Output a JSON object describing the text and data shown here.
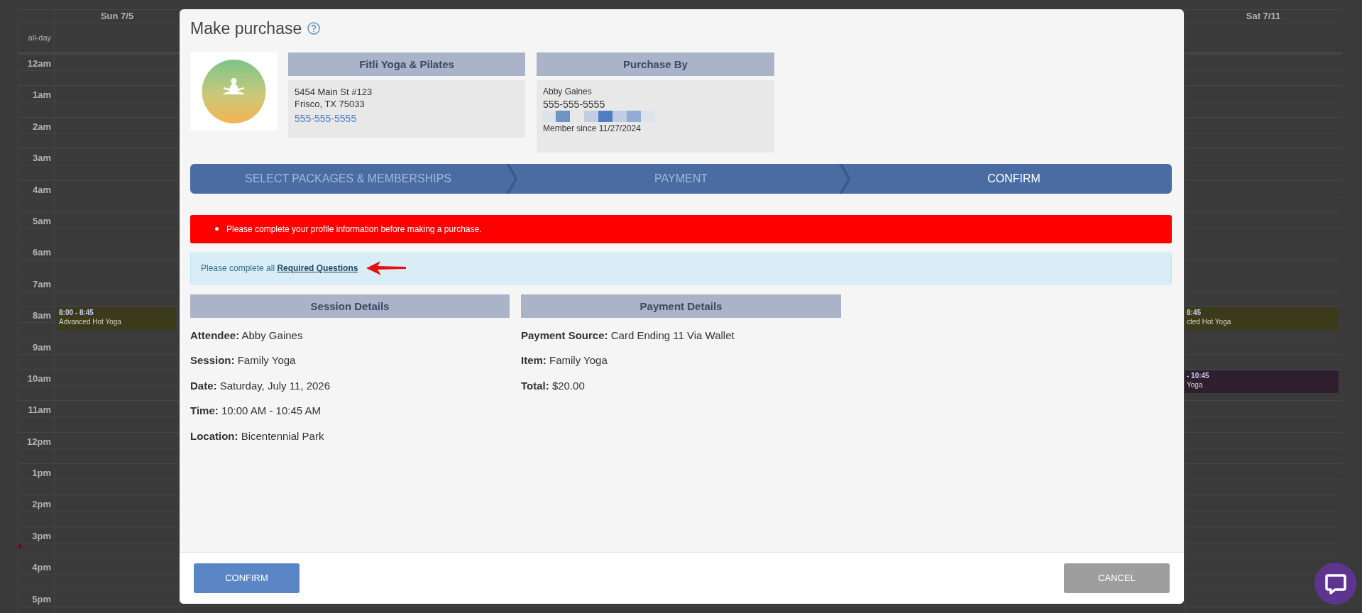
{
  "calendar": {
    "days": [
      {
        "label": "Sun 7/5"
      },
      {
        "label": "Sat 7/11"
      }
    ],
    "all_day_label": "all-day",
    "hours": [
      {
        "label": "12am",
        "now": false
      },
      {
        "label": "1am",
        "now": false
      },
      {
        "label": "2am",
        "now": false
      },
      {
        "label": "3am",
        "now": false
      },
      {
        "label": "4am",
        "now": false
      },
      {
        "label": "5am",
        "now": false
      },
      {
        "label": "6am",
        "now": false
      },
      {
        "label": "7am",
        "now": false
      },
      {
        "label": "8am",
        "now": false,
        "sun_event": {
          "time": "8:00 - 8:45",
          "title": "Advanced Hot Yoga",
          "color": "#3b3a1b"
        },
        "sat_event": {
          "time": "8:45",
          "title": "cted Hot Yoga",
          "color": "#3b3a1b"
        }
      },
      {
        "label": "9am",
        "now": false
      },
      {
        "label": "10am",
        "now": false,
        "sat_event": {
          "time": "- 10:45",
          "title": "Yoga",
          "color": "#2f1f2e"
        }
      },
      {
        "label": "11am",
        "now": false
      },
      {
        "label": "12pm",
        "now": false
      },
      {
        "label": "1pm",
        "now": false
      },
      {
        "label": "2pm",
        "now": false
      },
      {
        "label": "3pm",
        "now": true
      },
      {
        "label": "4pm",
        "now": false
      },
      {
        "label": "5pm",
        "now": false
      }
    ]
  },
  "modal": {
    "title": "Make purchase",
    "studio": {
      "heading": "Fitli Yoga & Pilates",
      "address_lines": [
        "5454 Main St #123",
        "Frisco, TX 75033"
      ],
      "phone": "555-555-5555"
    },
    "purchaser": {
      "heading": "Purchase By",
      "name": "Abby Gaines",
      "phone": "555-555-5555",
      "member_since": "Member since 11/27/2024"
    },
    "steps": [
      {
        "label": "SELECT PACKAGES & MEMBERSHIPS",
        "selected": false
      },
      {
        "label": "PAYMENT",
        "selected": false
      },
      {
        "label": "CONFIRM",
        "selected": true
      }
    ],
    "errors": [
      "Please complete your profile information before making a purchase."
    ],
    "info": {
      "text": "Please complete all ",
      "link": "Required Questions"
    },
    "session": {
      "heading": "Session Details",
      "lines": [
        {
          "label": "Attendee:",
          "value": "Abby Gaines"
        },
        {
          "label": "Session:",
          "value": "Family Yoga"
        },
        {
          "label": "Date:",
          "value": "Saturday, July 11, 2026"
        },
        {
          "label": "Time:",
          "value": "10:00 AM - 10:45 AM"
        },
        {
          "label": "Location:",
          "value": "Bicentennial Park"
        }
      ]
    },
    "payment": {
      "heading": "Payment Details",
      "lines": [
        {
          "label": "Payment Source:",
          "value": "Card Ending 11 Via Wallet"
        },
        {
          "label": "Item:",
          "value": "Family Yoga"
        },
        {
          "label": "Total:",
          "value": "$20.00"
        }
      ]
    },
    "buttons": [
      {
        "label": "CONFIRM",
        "kind": "primary"
      },
      {
        "label": "CANCEL",
        "kind": "secondary"
      }
    ]
  }
}
